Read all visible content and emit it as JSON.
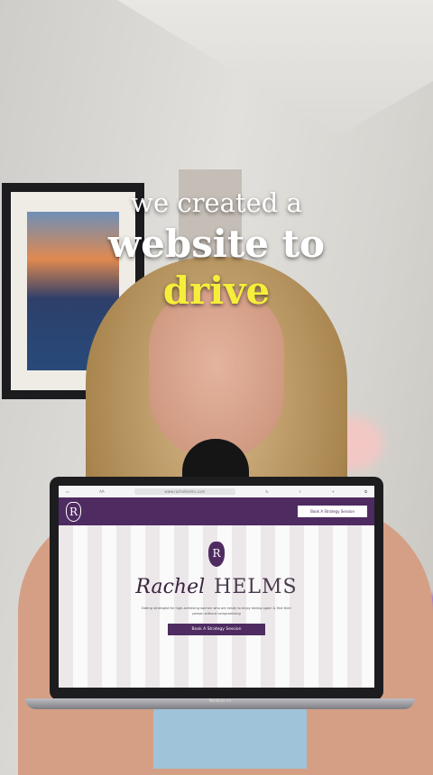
{
  "captions": {
    "line1": "we created a",
    "line2": "website to",
    "line3": "drive"
  },
  "laptop": {
    "label": "MacBook Air",
    "browser": {
      "text_size": "AA",
      "url": "www.rachelhelms.com"
    },
    "site": {
      "logo_letter": "R",
      "nav_button": "Book A Strategy Session",
      "first_name": "Rachel",
      "last_name": "HELMS",
      "tagline": "Dating strategist for high-achieving women who are ready to enjoy dating again & find their person without compromising",
      "cta_button": "Book A Strategy Session"
    }
  },
  "colors": {
    "brand": "#4e2b61",
    "highlight": "#f6ee3a"
  }
}
